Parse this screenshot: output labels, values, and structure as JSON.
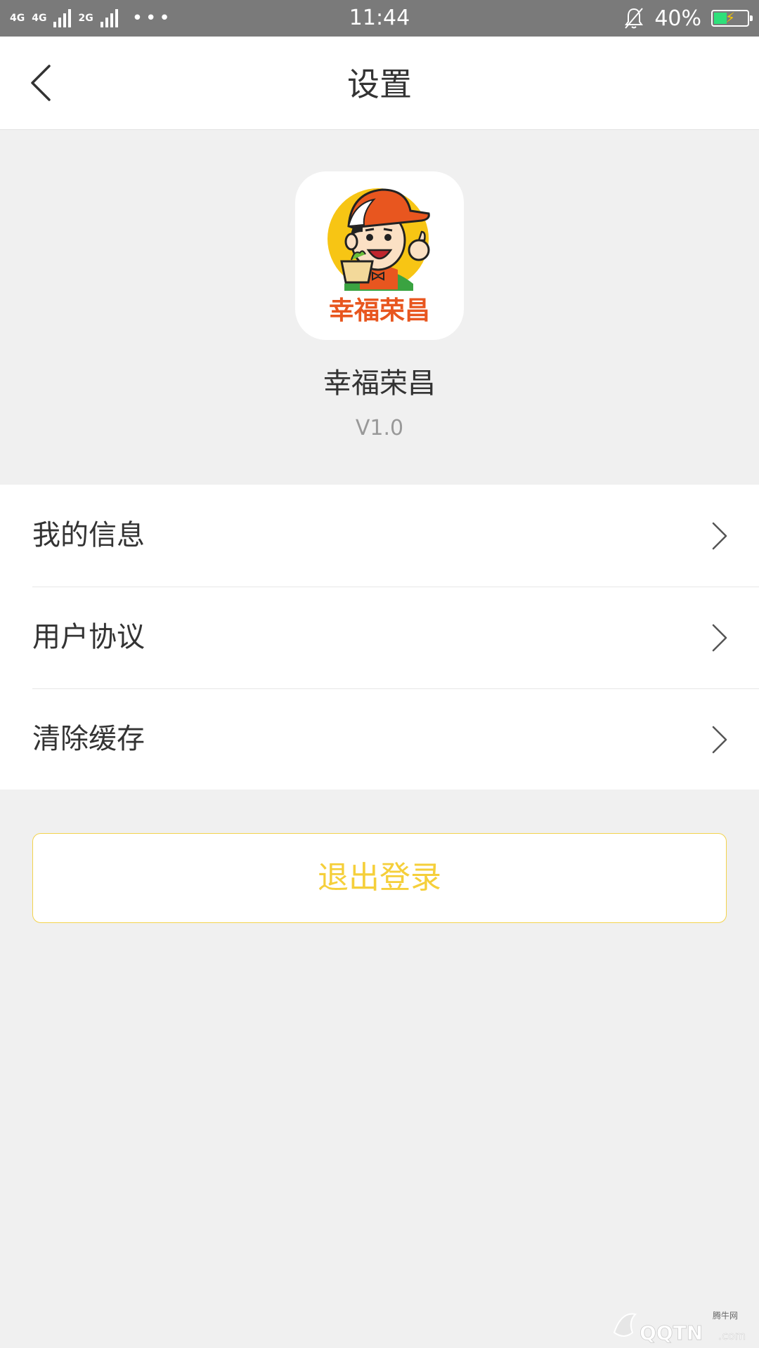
{
  "status_bar": {
    "network_1": "4G",
    "network_2": "4G",
    "network_3": "2G",
    "time": "11:44",
    "battery_percent": "40%",
    "battery_level": 0.4
  },
  "header": {
    "title": "设置"
  },
  "app_info": {
    "logo_text": "幸福荣昌",
    "name": "幸福荣昌",
    "version": "V1.0"
  },
  "menu": {
    "items": [
      {
        "label": "我的信息"
      },
      {
        "label": "用户协议"
      },
      {
        "label": "清除缓存"
      }
    ]
  },
  "actions": {
    "logout_label": "退出登录"
  },
  "watermark": {
    "text_top": "腾牛网",
    "text_main": "QQTN",
    "text_suffix": ".com"
  },
  "colors": {
    "accent_yellow": "#f5cf3a",
    "logo_orange": "#e8561f",
    "page_bg": "#f0f0f0"
  }
}
